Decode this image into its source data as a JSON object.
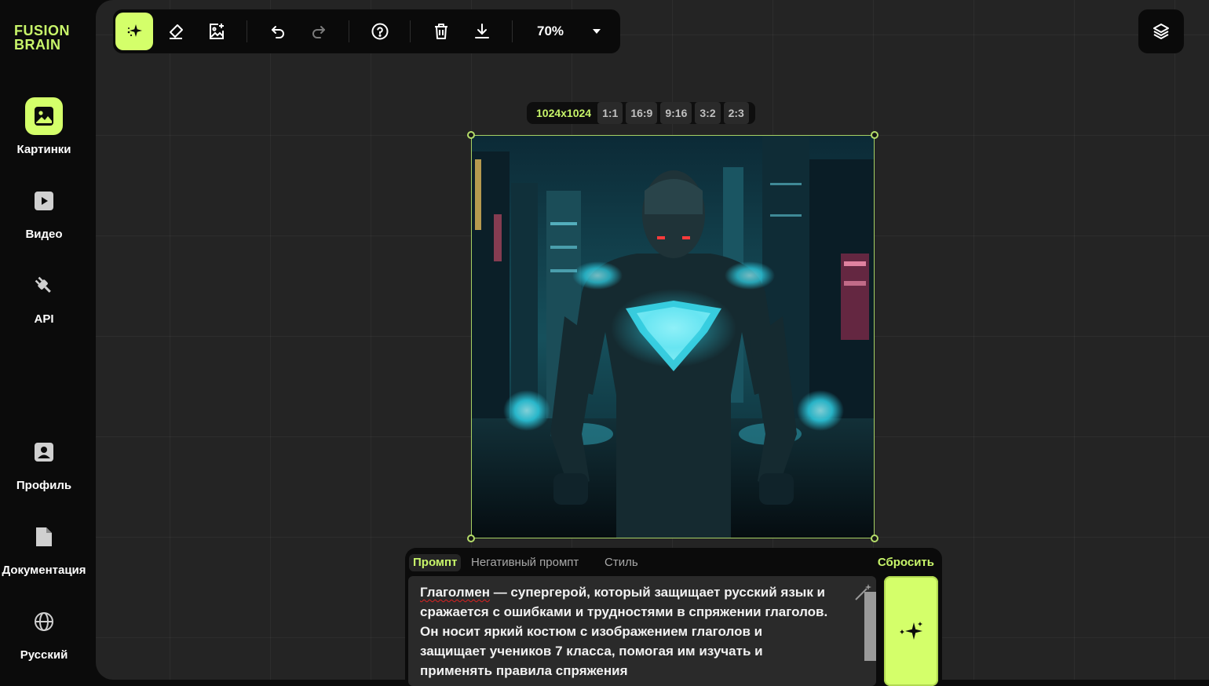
{
  "brand": {
    "line1": "FUSION",
    "line2": "BRAIN"
  },
  "sidebar": {
    "items": [
      {
        "label": "Картинки",
        "icon": "image-icon",
        "active": true
      },
      {
        "label": "Видео",
        "icon": "play-icon",
        "active": false
      },
      {
        "label": "API",
        "icon": "plug-icon",
        "active": false
      },
      {
        "label": "Профиль",
        "icon": "profile-icon",
        "active": false
      },
      {
        "label": "Документация",
        "icon": "document-icon",
        "active": false
      },
      {
        "label": "Русский",
        "icon": "globe-icon",
        "active": false
      }
    ]
  },
  "toolbar": {
    "tools": [
      "generate-sparkle-icon",
      "eraser-icon",
      "add-image-icon",
      "undo-icon",
      "redo-icon",
      "help-icon",
      "trash-icon",
      "download-icon"
    ],
    "zoom": "70%"
  },
  "size_bar": {
    "resolution": "1024x1024",
    "ratios": [
      "1:1",
      "16:9",
      "9:16",
      "3:2",
      "2:3"
    ],
    "selected_ratio": "1:1"
  },
  "prompt_panel": {
    "tabs": [
      "Промпт",
      "Негативный промпт",
      "Стиль"
    ],
    "active_tab": "Промпт",
    "reset_label": "Сбросить",
    "text_first_word": "Глаголмен",
    "text_rest": " — супергерой, который защищает русский язык и сражается с ошибками и трудностями в спряжении глаголов. Он носит яркий костюм с изображением глаголов и защищает учеников 7 класса, помогая им изучать и применять правила спряжения"
  },
  "colors": {
    "accent": "#d4ff6a",
    "accent_text": "#c8f56a",
    "canvas_bg": "#242424",
    "sidebar_bg": "#0b0b0b"
  }
}
